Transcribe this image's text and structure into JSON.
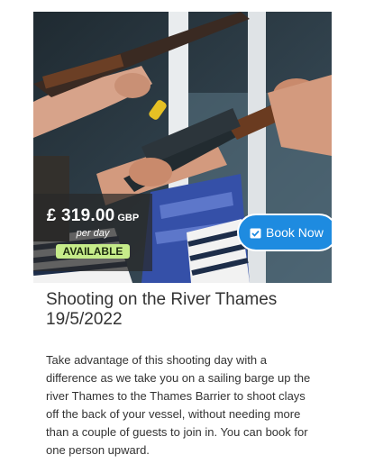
{
  "offer": {
    "price": "£ 319.00",
    "currency": "GBP",
    "per_unit": "per day",
    "status": "AVAILABLE",
    "book_label": "Book Now",
    "book_icon": "calendar-check-icon",
    "title_line1": "Shooting on the River Thames",
    "title_line2": "19/5/2022",
    "description": "Take advantage of this shooting day with a difference as we take you on a sailing barge up the river Thames to the Thames Barrier to shoot clays off the back of your vessel, without needing more than a couple of guests to join in. You can book for one person upward."
  },
  "colors": {
    "button": "#1e8be0",
    "badge": "#c6ec8a",
    "text": "#333333"
  }
}
